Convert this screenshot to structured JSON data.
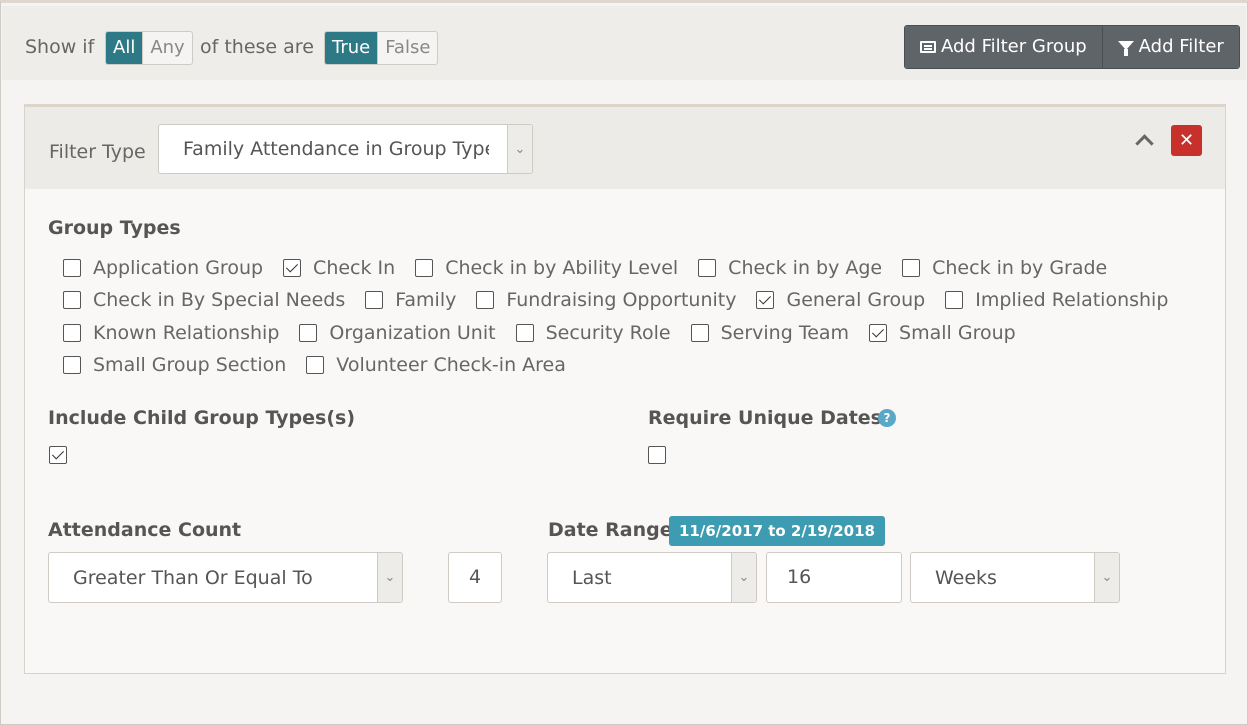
{
  "topbar": {
    "show_if": "Show if",
    "match_options": [
      "All",
      "Any"
    ],
    "match_selected": "All",
    "of_these_are": "of these are",
    "truth_options": [
      "True",
      "False"
    ],
    "truth_selected": "True",
    "add_filter_group": "Add Filter Group",
    "add_filter": "Add Filter"
  },
  "filter": {
    "type_label": "Filter Type",
    "type_value": "Family Attendance in Group Types",
    "group_types_label": "Group Types",
    "group_types": [
      {
        "label": "Application Group",
        "checked": false
      },
      {
        "label": "Check In",
        "checked": true
      },
      {
        "label": "Check in by Ability Level",
        "checked": false
      },
      {
        "label": "Check in by Age",
        "checked": false
      },
      {
        "label": "Check in by Grade",
        "checked": false
      },
      {
        "label": "Check in By Special Needs",
        "checked": false
      },
      {
        "label": "Family",
        "checked": false
      },
      {
        "label": "Fundraising Opportunity",
        "checked": false
      },
      {
        "label": "General Group",
        "checked": true
      },
      {
        "label": "Implied Relationship",
        "checked": false
      },
      {
        "label": "Known Relationship",
        "checked": false
      },
      {
        "label": "Organization Unit",
        "checked": false
      },
      {
        "label": "Security Role",
        "checked": false
      },
      {
        "label": "Serving Team",
        "checked": false
      },
      {
        "label": "Small Group",
        "checked": true
      },
      {
        "label": "Small Group Section",
        "checked": false
      },
      {
        "label": "Volunteer Check-in Area",
        "checked": false
      }
    ],
    "include_child_label": "Include Child Group Types(s)",
    "include_child_checked": true,
    "require_unique_label": "Require Unique Dates",
    "require_unique_checked": false,
    "attendance_count_label": "Attendance Count",
    "attendance_comparison": "Greater Than Or Equal To",
    "attendance_value": "4",
    "date_range_label": "Date Range",
    "date_range_badge": "11/6/2017 to 2/19/2018",
    "date_range_mode": "Last",
    "date_range_number": "16",
    "date_range_unit": "Weeks"
  },
  "colors": {
    "accent": "#2d7a86",
    "badge": "#3d9cb1",
    "danger": "#c8302c",
    "button": "#5f6468"
  }
}
